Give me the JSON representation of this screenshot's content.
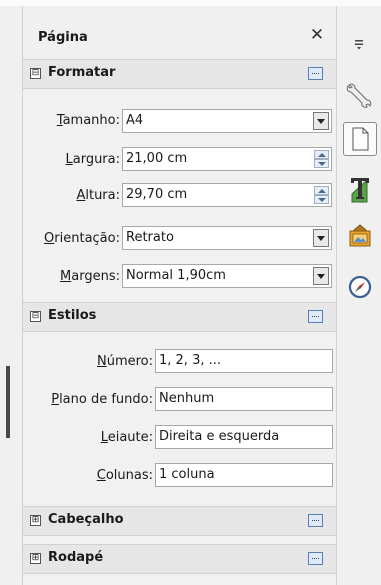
{
  "panel": {
    "title": "Página",
    "close_glyph": "✕"
  },
  "sections": {
    "formatar": {
      "expander": "⊟",
      "title": "Formatar",
      "fields": {
        "tamanho": {
          "label_key": "T",
          "label_rest": "amanho:",
          "value": "A4"
        },
        "largura": {
          "label_key": "L",
          "label_rest": "argura:",
          "value": "21,00 cm"
        },
        "altura": {
          "label_key": "A",
          "label_rest": "ltura:",
          "value": "29,70 cm"
        },
        "orientacao": {
          "label_key": "O",
          "label_rest": "rientação:",
          "value": "Retrato"
        },
        "margens": {
          "label_key": "M",
          "label_rest": "argens:",
          "value": "Normal 1,90cm"
        }
      }
    },
    "estilos": {
      "expander": "⊟",
      "title": "Estilos",
      "fields": {
        "numero": {
          "label_key": "N",
          "label_rest": "úmero:",
          "value": "1, 2, 3, ..."
        },
        "plano": {
          "label_key": "P",
          "label_rest": "lano de fundo:",
          "value": "Nenhum"
        },
        "leiaute": {
          "label_key": "L",
          "label_rest": "eiaute:",
          "value": "Direita e esquerda"
        },
        "colunas": {
          "label_key": "C",
          "label_rest": "olunas:",
          "value": "1 coluna"
        }
      }
    },
    "cabecalho": {
      "expander": "⊞",
      "title": "Cabeçalho"
    },
    "rodape": {
      "expander": "⊞",
      "title": "Rodapé"
    }
  },
  "tabbar": {
    "menu_icon": "sidebar-menu-icon",
    "tabs": [
      "properties-icon",
      "page-icon",
      "styles-icon",
      "gallery-icon",
      "navigator-icon"
    ]
  },
  "colors": {
    "accent": "#5a7fb5",
    "panel_bg": "#f1f1f1",
    "section_bg": "#e6e6e6"
  }
}
